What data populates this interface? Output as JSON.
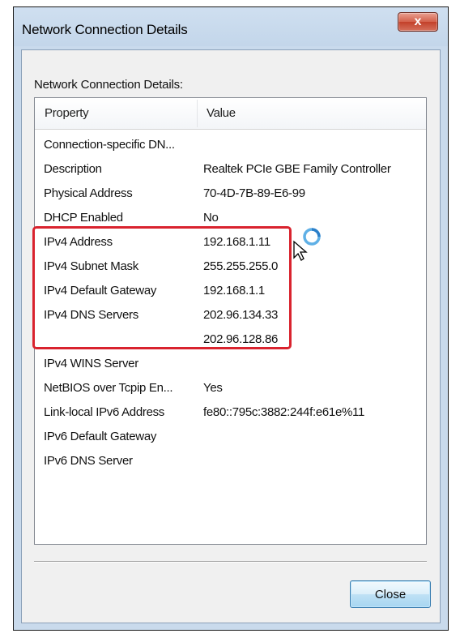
{
  "window": {
    "title": "Network Connection Details",
    "close_glyph": "x"
  },
  "group": {
    "label": "Network Connection Details:"
  },
  "table": {
    "columns": [
      "Property",
      "Value"
    ],
    "rows": [
      {
        "property": "Connection-specific DN...",
        "value": ""
      },
      {
        "property": "Description",
        "value": "Realtek PCIe GBE Family Controller"
      },
      {
        "property": "Physical Address",
        "value": "70-4D-7B-89-E6-99"
      },
      {
        "property": "DHCP Enabled",
        "value": "No"
      },
      {
        "property": "IPv4 Address",
        "value": "192.168.1.11"
      },
      {
        "property": "IPv4 Subnet Mask",
        "value": "255.255.255.0"
      },
      {
        "property": "IPv4 Default Gateway",
        "value": "192.168.1.1"
      },
      {
        "property": "IPv4 DNS Servers",
        "value": "202.96.134.33"
      },
      {
        "property": "",
        "value": "202.96.128.86"
      },
      {
        "property": "IPv4 WINS Server",
        "value": ""
      },
      {
        "property": "NetBIOS over Tcpip En...",
        "value": "Yes"
      },
      {
        "property": "Link-local IPv6 Address",
        "value": "fe80::795c:3882:244f:e61e%11"
      },
      {
        "property": "IPv6 Default Gateway",
        "value": ""
      },
      {
        "property": "IPv6 DNS Server",
        "value": ""
      }
    ]
  },
  "buttons": {
    "close_label": "Close"
  },
  "annotation": {
    "highlight_color": "#d9232e",
    "cursor_icon": "busy-cursor-icon"
  }
}
